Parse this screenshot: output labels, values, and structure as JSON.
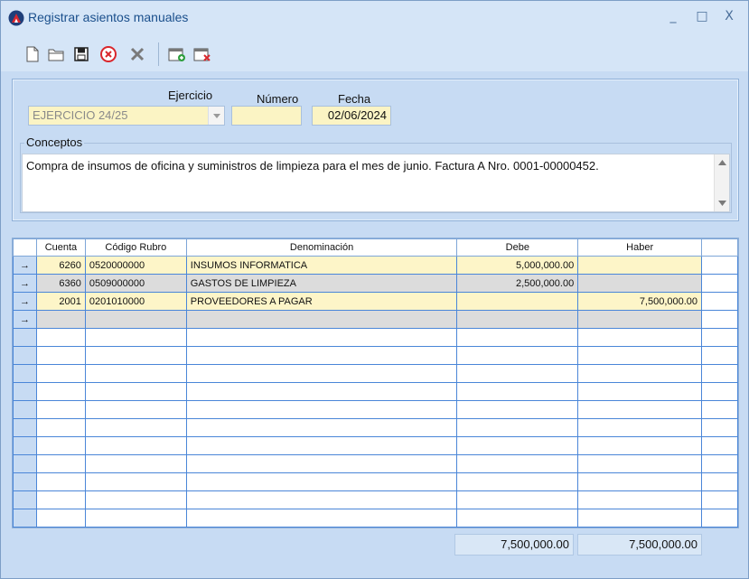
{
  "window": {
    "title": "Registrar asientos manuales",
    "minimize": "_",
    "maximize": "□",
    "close": "X"
  },
  "toolbar": {
    "icons": [
      "new-document-icon",
      "open-folder-icon",
      "save-icon",
      "cancel-circle-icon",
      "delete-x-icon",
      "add-calendar-icon",
      "remove-calendar-icon"
    ]
  },
  "header": {
    "ejercicio_label": "Ejercicio",
    "ejercicio_value": "EJERCICIO 24/25",
    "numero_label": "Número",
    "numero_value": "",
    "fecha_label": "Fecha",
    "fecha_value": "02/06/2024"
  },
  "concepts": {
    "label": "Conceptos",
    "text": "Compra de insumos de oficina y suministros de limpieza para el mes de junio. Factura A Nro. 0001-00000452."
  },
  "grid": {
    "columns": [
      "",
      "Cuenta",
      "Código Rubro",
      "Denominación",
      "Debe",
      "Haber",
      ""
    ],
    "rows": [
      {
        "arrow": "→",
        "cuenta": "6260",
        "codigo": "0520000000",
        "denominacion": "INSUMOS INFORMATICA",
        "debe": "5,000,000.00",
        "haber": "",
        "style": "yellow"
      },
      {
        "arrow": "→",
        "cuenta": "6360",
        "codigo": "0509000000",
        "denominacion": "GASTOS DE LIMPIEZA",
        "debe": "2,500,000.00",
        "haber": "",
        "style": "gray"
      },
      {
        "arrow": "→",
        "cuenta": "2001",
        "codigo": "0201010000",
        "denominacion": "PROVEEDORES A PAGAR",
        "debe": "",
        "haber": "7,500,000.00",
        "style": "yellow"
      },
      {
        "arrow": "→",
        "cuenta": "",
        "codigo": "",
        "denominacion": "",
        "debe": "",
        "haber": "",
        "style": "gray"
      }
    ],
    "empty_rows": 11
  },
  "totals": {
    "debe": "7,500,000.00",
    "haber": "7,500,000.00"
  }
}
